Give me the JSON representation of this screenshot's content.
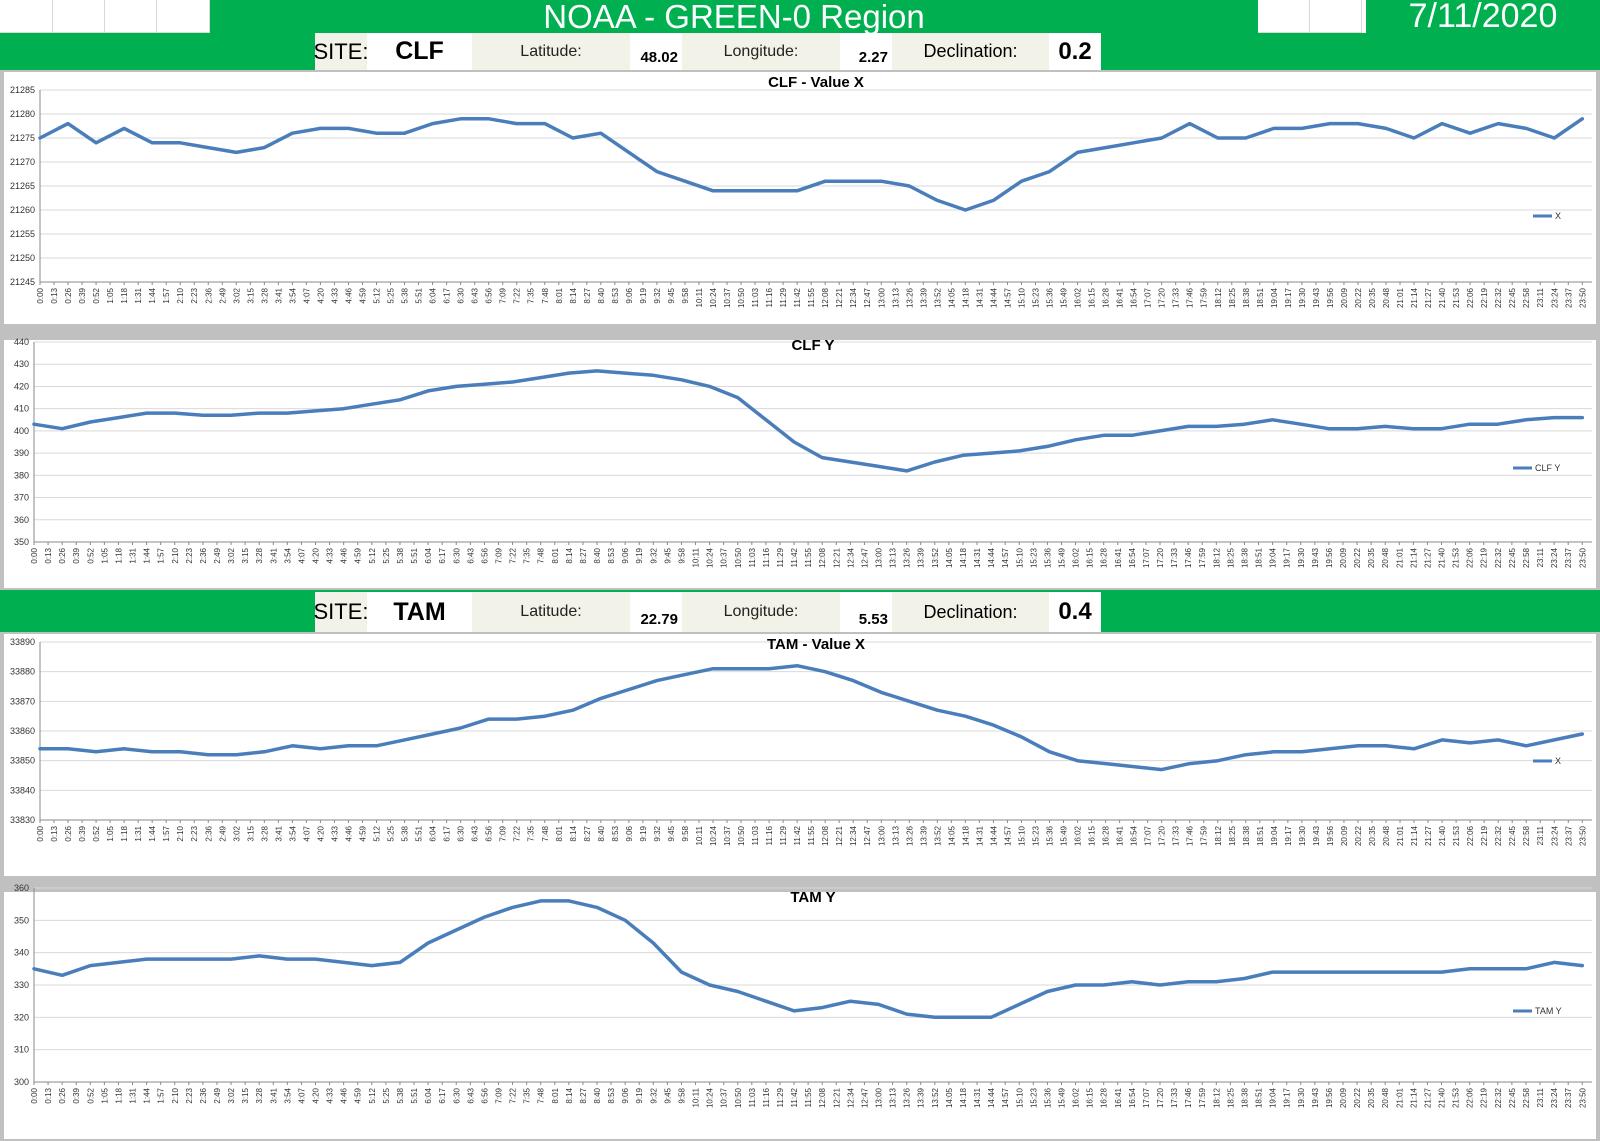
{
  "header": {
    "title": "NOAA - GREEN-0 Region",
    "date": "7/11/2020"
  },
  "sites": [
    {
      "site_label": "SITE:",
      "site": "CLF",
      "lat_label": "Latitude:",
      "lat": "48.02",
      "lon_label": "Longitude:",
      "lon": "2.27",
      "dec_label": "Declination:",
      "dec": "0.2"
    },
    {
      "site_label": "SITE:",
      "site": "TAM",
      "lat_label": "Latitude:",
      "lat": "22.79",
      "lon_label": "Longitude:",
      "lon": "5.53",
      "dec_label": "Declination:",
      "dec": "0.4"
    }
  ],
  "colors": {
    "green": "#00b050",
    "series": "#4a7ebb",
    "panel": "#c0c0c0",
    "grid": "#d9d9d9"
  },
  "chart_data": [
    {
      "type": "line",
      "title": "CLF - Value X",
      "legend": "X",
      "legend_position": "right",
      "ylim": [
        21245,
        21285
      ],
      "yticks": [
        21245,
        21250,
        21255,
        21260,
        21265,
        21270,
        21275,
        21280,
        21285
      ],
      "x_tick_step_min": 13,
      "x_range": [
        "0:00",
        "23:59"
      ],
      "grid": true,
      "x": [
        "0:00",
        "0:26",
        "0:52",
        "1:18",
        "1:44",
        "2:10",
        "2:36",
        "3:02",
        "3:28",
        "3:54",
        "4:20",
        "4:46",
        "5:12",
        "5:38",
        "6:04",
        "6:30",
        "6:56",
        "7:22",
        "7:48",
        "8:14",
        "8:40",
        "9:06",
        "9:32",
        "9:58",
        "10:24",
        "10:50",
        "11:16",
        "11:42",
        "12:08",
        "12:34",
        "13:00",
        "13:26",
        "13:52",
        "14:18",
        "14:44",
        "15:10",
        "15:36",
        "16:02",
        "16:28",
        "16:54",
        "17:20",
        "17:46",
        "18:12",
        "18:38",
        "19:04",
        "19:30",
        "19:56",
        "20:22",
        "20:48",
        "21:14",
        "21:40",
        "22:06",
        "22:32",
        "22:58",
        "23:24",
        "23:50"
      ],
      "values": [
        21275,
        21278,
        21274,
        21277,
        21274,
        21274,
        21273,
        21272,
        21273,
        21276,
        21277,
        21277,
        21276,
        21276,
        21278,
        21279,
        21279,
        21278,
        21278,
        21275,
        21276,
        21272,
        21268,
        21266,
        21264,
        21264,
        21264,
        21264,
        21266,
        21266,
        21266,
        21265,
        21262,
        21260,
        21262,
        21266,
        21268,
        21272,
        21273,
        21274,
        21275,
        21278,
        21275,
        21275,
        21277,
        21277,
        21278,
        21278,
        21277,
        21275,
        21278,
        21276,
        21278,
        21277,
        21275,
        21279
      ]
    },
    {
      "type": "line",
      "title": "CLF Y",
      "legend": "CLF Y",
      "legend_position": "right",
      "ylim": [
        350,
        440
      ],
      "yticks": [
        350,
        360,
        370,
        380,
        390,
        400,
        410,
        420,
        430,
        440
      ],
      "x_tick_step_min": 13,
      "x_range": [
        "0:00",
        "23:59"
      ],
      "grid": true,
      "x": [
        "0:00",
        "0:26",
        "0:52",
        "1:18",
        "1:44",
        "2:10",
        "2:36",
        "3:02",
        "3:28",
        "3:54",
        "4:20",
        "4:46",
        "5:12",
        "5:38",
        "6:04",
        "6:30",
        "6:56",
        "7:22",
        "7:48",
        "8:14",
        "8:40",
        "9:06",
        "9:32",
        "9:58",
        "10:24",
        "10:50",
        "11:16",
        "11:42",
        "12:08",
        "12:34",
        "13:00",
        "13:26",
        "13:52",
        "14:18",
        "14:44",
        "15:10",
        "15:36",
        "16:02",
        "16:28",
        "16:54",
        "17:20",
        "17:46",
        "18:12",
        "18:38",
        "19:04",
        "19:30",
        "19:56",
        "20:22",
        "20:48",
        "21:14",
        "21:40",
        "22:06",
        "22:32",
        "22:58",
        "23:24",
        "23:50"
      ],
      "values": [
        403,
        401,
        404,
        406,
        408,
        408,
        407,
        407,
        408,
        408,
        409,
        410,
        412,
        414,
        418,
        420,
        421,
        422,
        424,
        426,
        427,
        426,
        425,
        423,
        420,
        415,
        405,
        395,
        388,
        386,
        384,
        382,
        386,
        389,
        390,
        391,
        393,
        396,
        398,
        398,
        400,
        402,
        402,
        403,
        405,
        403,
        401,
        401,
        402,
        401,
        401,
        403,
        403,
        405,
        406,
        406
      ]
    },
    {
      "type": "line",
      "title": "TAM - Value X",
      "legend": "X",
      "legend_position": "right",
      "ylim": [
        33830,
        33890
      ],
      "yticks": [
        33830,
        33840,
        33850,
        33860,
        33870,
        33880,
        33890
      ],
      "x_tick_step_min": 13,
      "x_range": [
        "0:00",
        "23:59"
      ],
      "grid": true,
      "x": [
        "0:00",
        "0:26",
        "0:52",
        "1:18",
        "1:44",
        "2:10",
        "2:36",
        "3:02",
        "3:28",
        "3:54",
        "4:20",
        "4:46",
        "5:12",
        "5:38",
        "6:04",
        "6:30",
        "6:56",
        "7:22",
        "7:48",
        "8:14",
        "8:40",
        "9:06",
        "9:32",
        "9:58",
        "10:24",
        "10:50",
        "11:16",
        "11:42",
        "12:08",
        "12:34",
        "13:00",
        "13:26",
        "13:52",
        "14:18",
        "14:44",
        "15:10",
        "15:36",
        "16:02",
        "16:28",
        "16:54",
        "17:20",
        "17:46",
        "18:12",
        "18:38",
        "19:04",
        "19:30",
        "19:56",
        "20:22",
        "20:48",
        "21:14",
        "21:40",
        "22:06",
        "22:32",
        "22:58",
        "23:24",
        "23:50"
      ],
      "values": [
        33854,
        33854,
        33853,
        33854,
        33853,
        33853,
        33852,
        33852,
        33853,
        33855,
        33854,
        33855,
        33855,
        33857,
        33859,
        33861,
        33864,
        33864,
        33865,
        33867,
        33871,
        33874,
        33877,
        33879,
        33881,
        33881,
        33881,
        33882,
        33880,
        33877,
        33873,
        33870,
        33867,
        33865,
        33862,
        33858,
        33853,
        33850,
        33849,
        33848,
        33847,
        33849,
        33850,
        33852,
        33853,
        33853,
        33854,
        33855,
        33855,
        33854,
        33857,
        33856,
        33857,
        33855,
        33857,
        33859
      ]
    },
    {
      "type": "line",
      "title": "TAM Y",
      "legend": "TAM Y",
      "legend_position": "right",
      "ylim": [
        300,
        360
      ],
      "yticks": [
        300,
        310,
        320,
        330,
        340,
        350,
        360
      ],
      "x_tick_step_min": 13,
      "x_range": [
        "0:00",
        "23:59"
      ],
      "grid": true,
      "x": [
        "0:00",
        "0:26",
        "0:52",
        "1:18",
        "1:44",
        "2:10",
        "2:36",
        "3:02",
        "3:28",
        "3:54",
        "4:20",
        "4:46",
        "5:12",
        "5:38",
        "6:04",
        "6:30",
        "6:56",
        "7:22",
        "7:48",
        "8:14",
        "8:40",
        "9:06",
        "9:32",
        "9:58",
        "10:24",
        "10:50",
        "11:16",
        "11:42",
        "12:08",
        "12:34",
        "13:00",
        "13:26",
        "13:52",
        "14:18",
        "14:44",
        "15:10",
        "15:36",
        "16:02",
        "16:28",
        "16:54",
        "17:20",
        "17:46",
        "18:12",
        "18:38",
        "19:04",
        "19:30",
        "19:56",
        "20:22",
        "20:48",
        "21:14",
        "21:40",
        "22:06",
        "22:32",
        "22:58",
        "23:24",
        "23:50"
      ],
      "values": [
        335,
        333,
        336,
        337,
        338,
        338,
        338,
        338,
        339,
        338,
        338,
        337,
        336,
        337,
        343,
        347,
        351,
        354,
        356,
        356,
        354,
        350,
        343,
        334,
        330,
        328,
        325,
        322,
        323,
        325,
        324,
        321,
        320,
        320,
        320,
        324,
        328,
        330,
        330,
        331,
        330,
        331,
        331,
        332,
        334,
        334,
        334,
        334,
        334,
        334,
        334,
        335,
        335,
        335,
        337,
        336
      ]
    }
  ]
}
